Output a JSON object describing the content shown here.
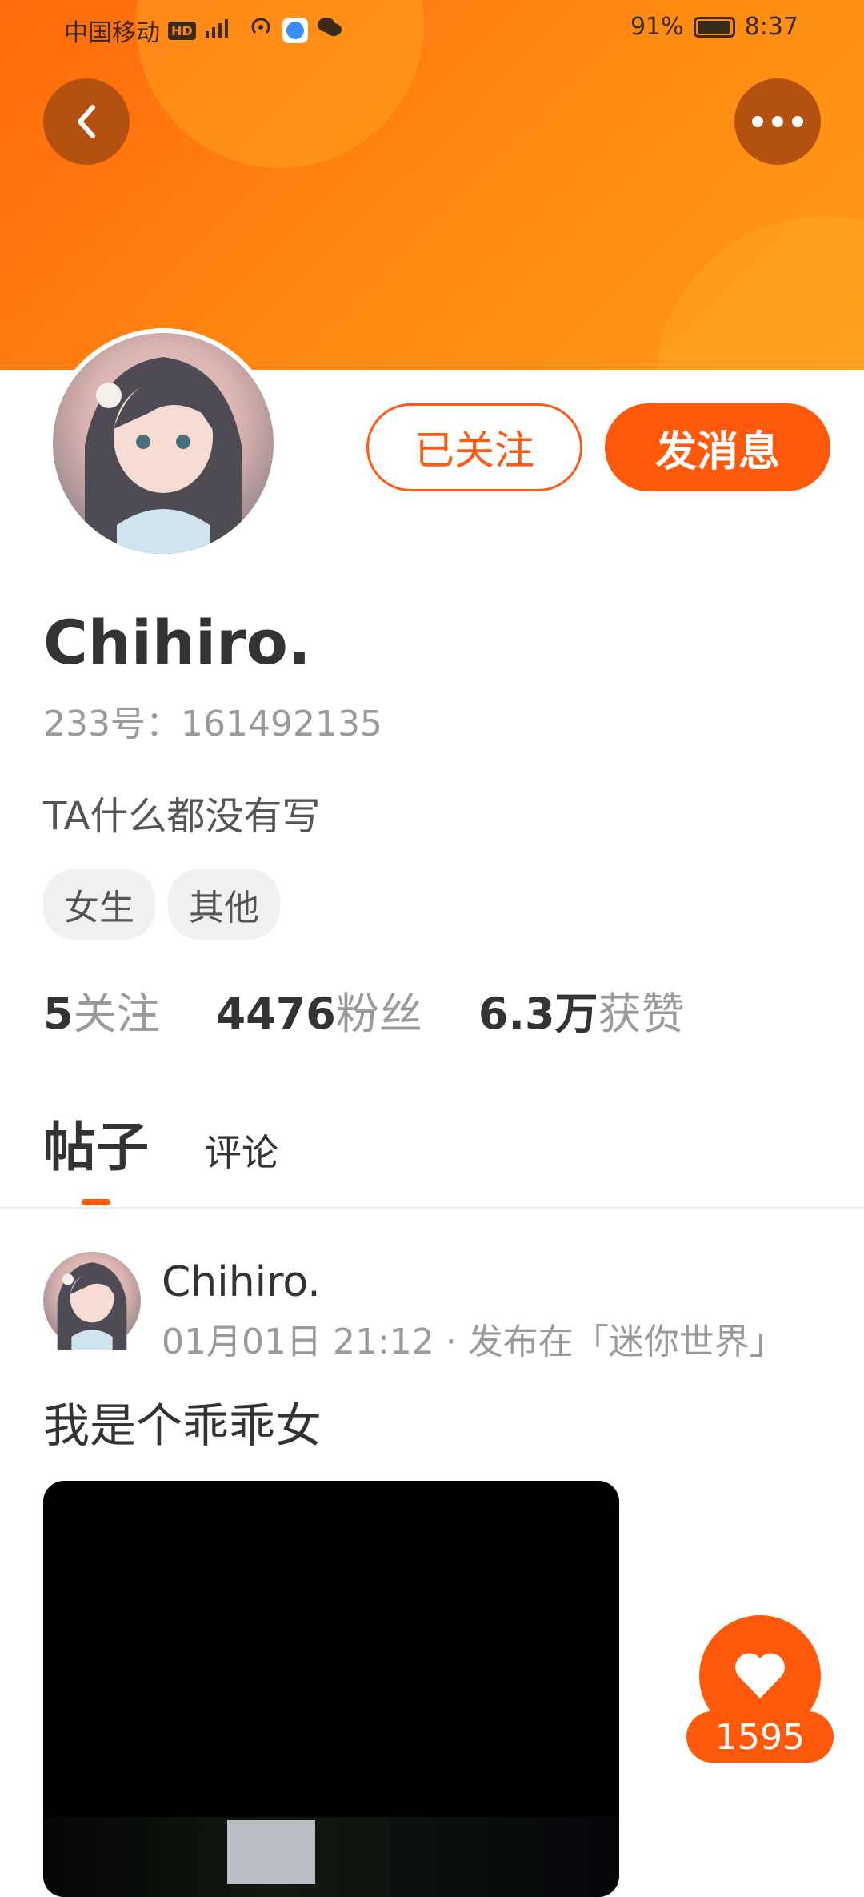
{
  "status_bar": {
    "carrier": "中国移动",
    "hd": "HD",
    "network": "4G",
    "battery": "91%",
    "time": "8:37"
  },
  "profile": {
    "name": "Chihiro.",
    "uid": "233号：161492135",
    "bio": "TA什么都没有写",
    "tags": [
      "女生",
      "其他"
    ],
    "stats": [
      {
        "num": "5",
        "label": "关注"
      },
      {
        "num": "4476",
        "label": "粉丝"
      },
      {
        "num": "6.3万",
        "label": "获赞"
      }
    ]
  },
  "actions": {
    "followed_label": "已关注",
    "message_label": "发消息"
  },
  "tabs": {
    "posts": "帖子",
    "comments": "评论"
  },
  "post": {
    "author": "Chihiro.",
    "meta": "01月01日 21:12 · 发布在「迷你世界」",
    "text": "我是个乖乖女",
    "like_count": "1595"
  },
  "colors": {
    "accent": "#ff5a0c",
    "header": "#ff7a10"
  }
}
